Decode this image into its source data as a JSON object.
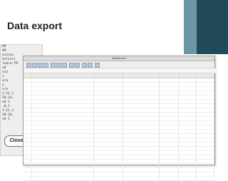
{
  "slide": {
    "title": "Data export"
  },
  "console": {
    "lines": [
      "##",
      "##",
      "essons",
      "",
      "",
      "Selecti",
      "ledra-TM",
      "",
      "ed",
      "",
      "",
      "n/a",
      "",
      "",
      "s",
      "",
      "n/a",
      "",
      "  n",
      "",
      "n/a",
      "",
      "1:11,1",
      " 28-14,",
      "ed 1",
      ",0,1",
      "",
      "1:11,1",
      " 28-14,",
      "ed 1",
      ""
    ],
    "close_label": "Close"
  },
  "sheet": {
    "window_title": "Workbook1",
    "formula_text": "",
    "columns": [
      "",
      "",
      "",
      "",
      "",
      "",
      ""
    ],
    "rows": []
  }
}
